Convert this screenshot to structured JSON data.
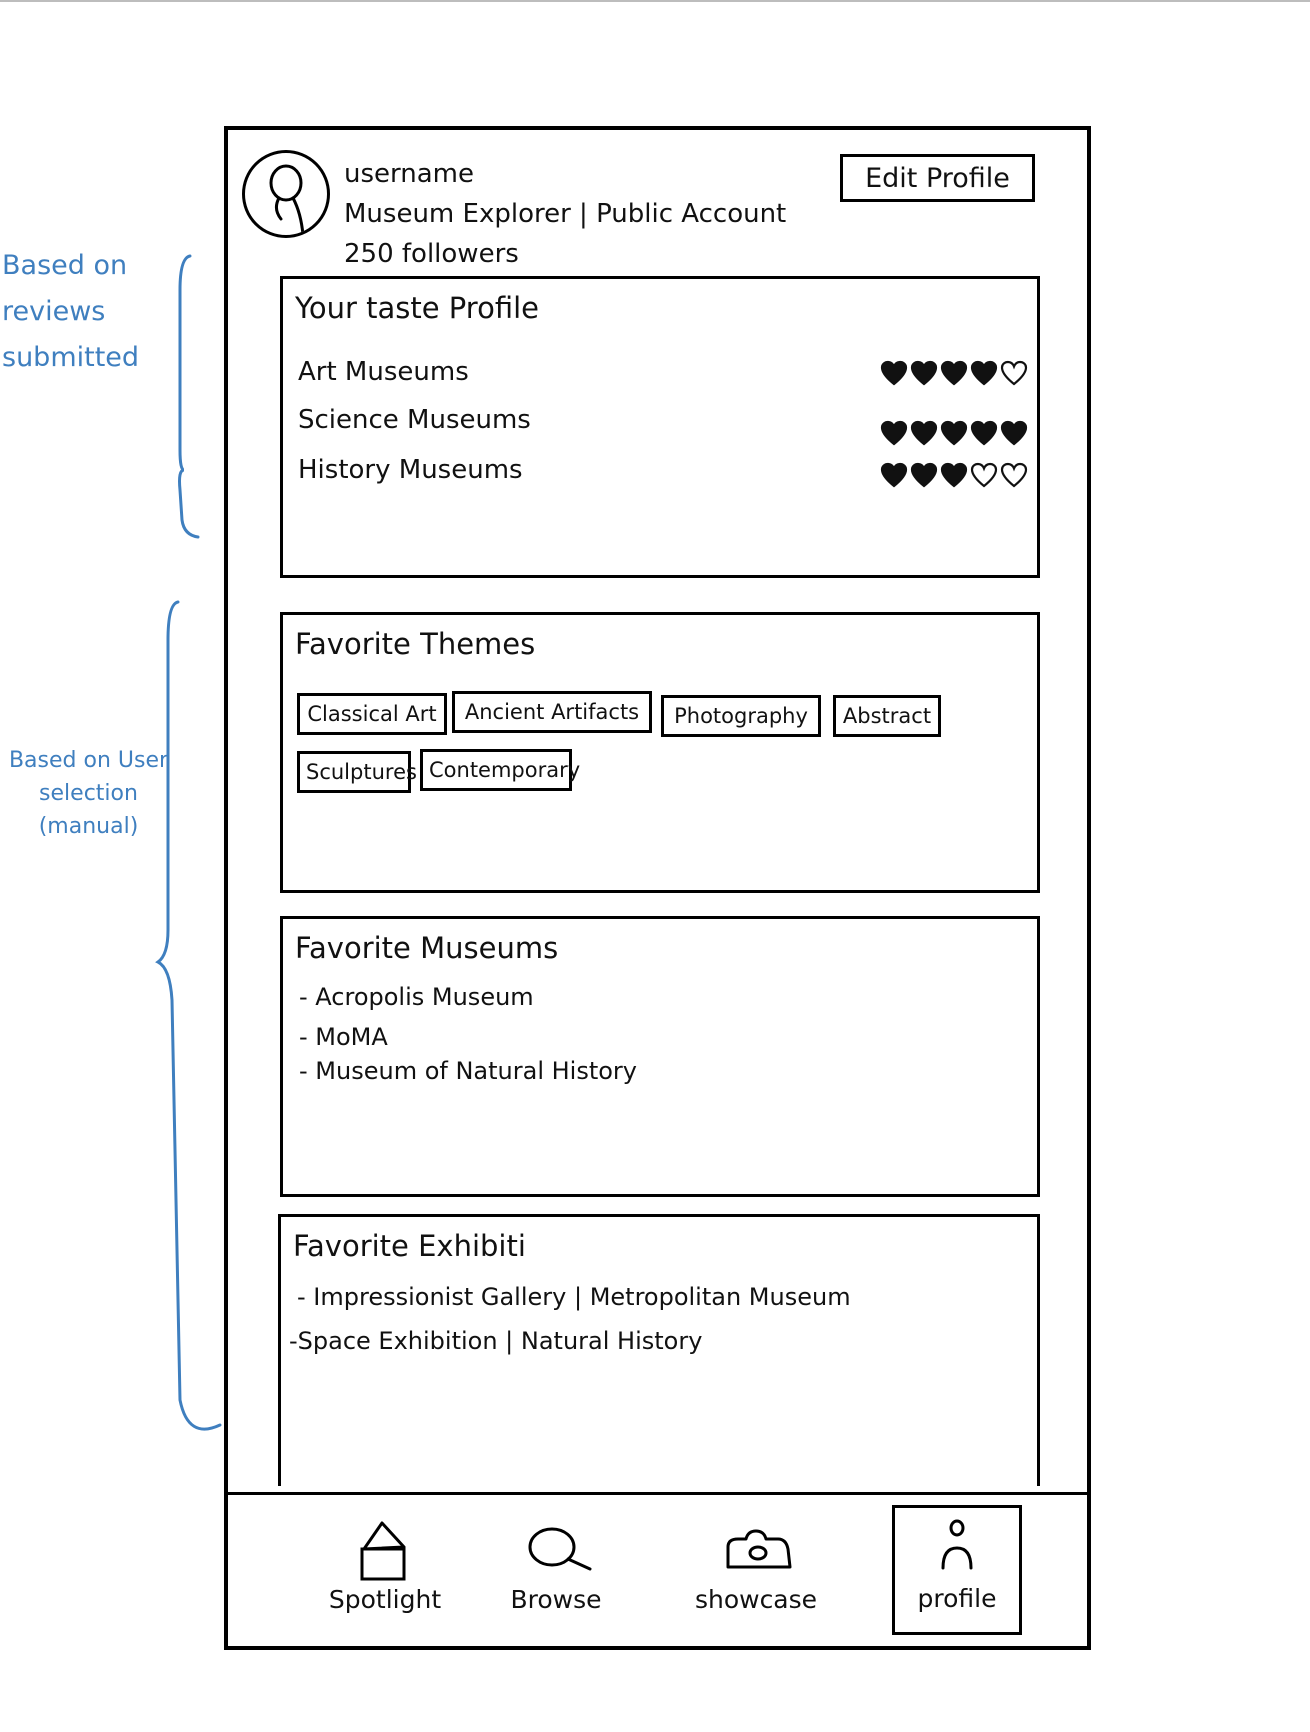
{
  "annotations": {
    "taste_note": "Based on reviews submitted",
    "themes_note": "Based on User selection (manual)"
  },
  "profile": {
    "username": "username",
    "account_type": "Museum Explorer | Public Account",
    "followers": "250 followers",
    "edit_label": "Edit Profile",
    "avatar_icon": "person-avatar-icon"
  },
  "taste_profile": {
    "title": "Your taste Profile",
    "rows": [
      {
        "label": "Art Museums",
        "rating": 4,
        "max": 5
      },
      {
        "label": "Science Museums",
        "rating": 5,
        "max": 5
      },
      {
        "label": "History Museums",
        "rating": 3,
        "max": 5
      }
    ]
  },
  "favorite_themes": {
    "title": "Favorite Themes",
    "chips": [
      "Classical Art",
      "Ancient Artifacts",
      "Photography",
      "Abstract",
      "Sculptures",
      "Contemporary"
    ]
  },
  "favorite_museums": {
    "title": "Favorite Museums",
    "items": [
      "- Acropolis Museum",
      "- MoMA",
      "- Museum of Natural History"
    ]
  },
  "favorite_exhibits": {
    "title": "Favorite Exhibiti",
    "items": [
      "- Impressionist Gallery | Metropolitan Museum",
      "-Space Exhibition | Natural History"
    ]
  },
  "nav": {
    "items": [
      {
        "label": "Spotlight",
        "icon": "house-icon"
      },
      {
        "label": "Browse",
        "icon": "search-icon"
      },
      {
        "label": "showcase",
        "icon": "camera-icon"
      },
      {
        "label": "profile",
        "icon": "person-icon",
        "active": true
      }
    ]
  }
}
